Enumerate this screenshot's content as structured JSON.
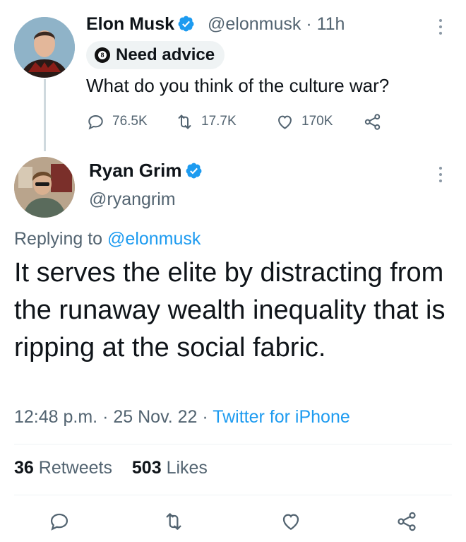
{
  "tweet1": {
    "author_name": "Elon Musk",
    "author_handle": "@elonmusk",
    "time": "· 11h",
    "badge_label": "Need advice",
    "badge_ball_number": "8",
    "text": "What do you think of the culture war?",
    "replies": "76.5K",
    "retweets": "17.7K",
    "likes": "170K"
  },
  "tweet2": {
    "author_name": "Ryan Grim",
    "author_handle": "@ryangrim",
    "replying_prefix": "Replying to ",
    "replying_handle": "@elonmusk",
    "text": "It serves the elite by distracting from the runaway wealth inequality that is ripping at the social fabric.",
    "time": "12:48 p.m.",
    "date": "25 Nov. 22",
    "source": "Twitter for iPhone",
    "retweet_count": "36",
    "retweet_label": "Retweets",
    "like_count": "503",
    "like_label": "Likes"
  },
  "colors": {
    "accent": "#1d9bf0",
    "secondary_text": "#536471",
    "primary_text": "#0f1419"
  },
  "icons": [
    "verified-badge-icon",
    "reply-icon",
    "retweet-icon",
    "like-icon",
    "share-icon",
    "more-icon",
    "eight-ball-icon"
  ]
}
